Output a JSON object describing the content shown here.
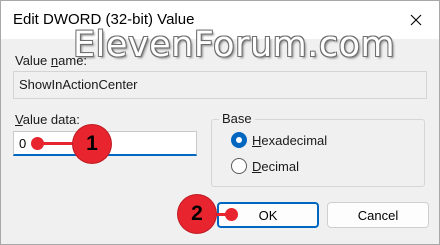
{
  "window": {
    "title": "Edit DWORD (32-bit) Value",
    "close_icon": "close-icon"
  },
  "watermark": "ElevenForum.com",
  "value_name": {
    "label_prefix": "Value ",
    "label_underlined": "n",
    "label_suffix": "ame:",
    "value": "ShowInActionCenter"
  },
  "value_data": {
    "label_underlined": "V",
    "label_suffix": "alue data:",
    "value": "0"
  },
  "base": {
    "label": "Base",
    "options": [
      {
        "underlined": "H",
        "rest": "exadecimal",
        "checked": true
      },
      {
        "underlined": "D",
        "rest": "ecimal",
        "checked": false
      }
    ]
  },
  "buttons": {
    "ok_label": "OK",
    "cancel_label": "Cancel"
  },
  "annotations": [
    {
      "number": "1"
    },
    {
      "number": "2"
    }
  ],
  "colors": {
    "accent": "#0067c0",
    "annotation_red": "#e8242e"
  }
}
